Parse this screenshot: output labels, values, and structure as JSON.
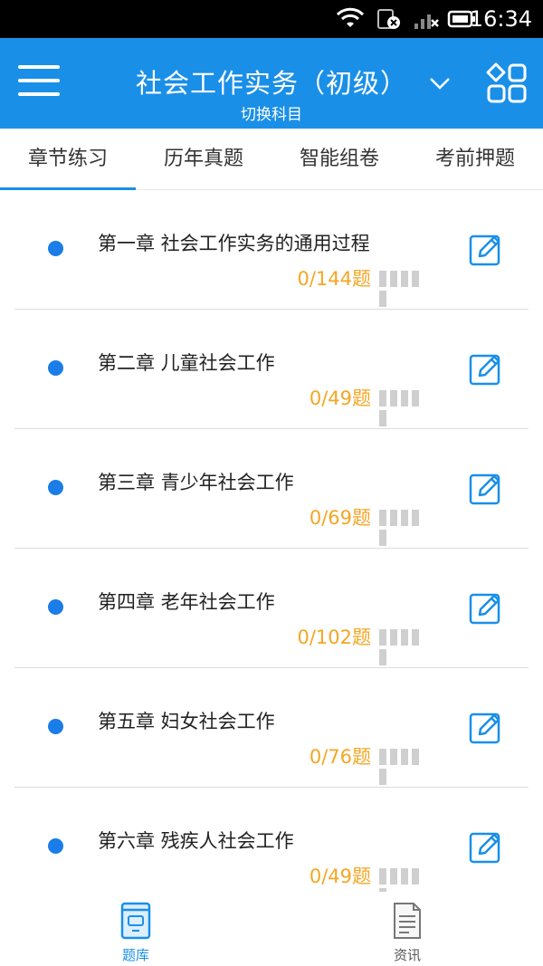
{
  "status_bar": {
    "time": "16:34",
    "icons": [
      "wifi-icon",
      "sim-blocked-icon",
      "signal-icon",
      "battery-icon"
    ]
  },
  "header": {
    "menu_icon": "hamburger-menu-icon",
    "title": "社会工作实务（初级）",
    "subtitle": "切换科目",
    "dropdown_icon": "chevron-down-icon",
    "grid_icon": "grid-apps-icon"
  },
  "tabs": [
    {
      "label": "章节练习",
      "active": true
    },
    {
      "label": "历年真题",
      "active": false
    },
    {
      "label": "智能组卷",
      "active": false
    },
    {
      "label": "考前押题",
      "active": false
    }
  ],
  "chapters": [
    {
      "title": "第一章 社会工作实务的通用过程",
      "progress": "0/144题",
      "done": 0,
      "total": 144
    },
    {
      "title": "第二章 儿童社会工作",
      "progress": "0/49题",
      "done": 0,
      "total": 49
    },
    {
      "title": "第三章 青少年社会工作",
      "progress": "0/69题",
      "done": 0,
      "total": 69
    },
    {
      "title": "第四章 老年社会工作",
      "progress": "0/102题",
      "done": 0,
      "total": 102
    },
    {
      "title": "第五章 妇女社会工作",
      "progress": "0/76题",
      "done": 0,
      "total": 76
    },
    {
      "title": "第六章 残疾人社会工作",
      "progress": "0/49题",
      "done": 0,
      "total": 49
    }
  ],
  "bottom_nav": [
    {
      "label": "题库",
      "icon": "question-bank-icon",
      "active": true
    },
    {
      "label": "资讯",
      "icon": "news-document-icon",
      "active": false
    }
  ],
  "colors": {
    "primary": "#1a8fe8",
    "accent_orange": "#f5a623",
    "dot_blue": "#1a7de8"
  }
}
